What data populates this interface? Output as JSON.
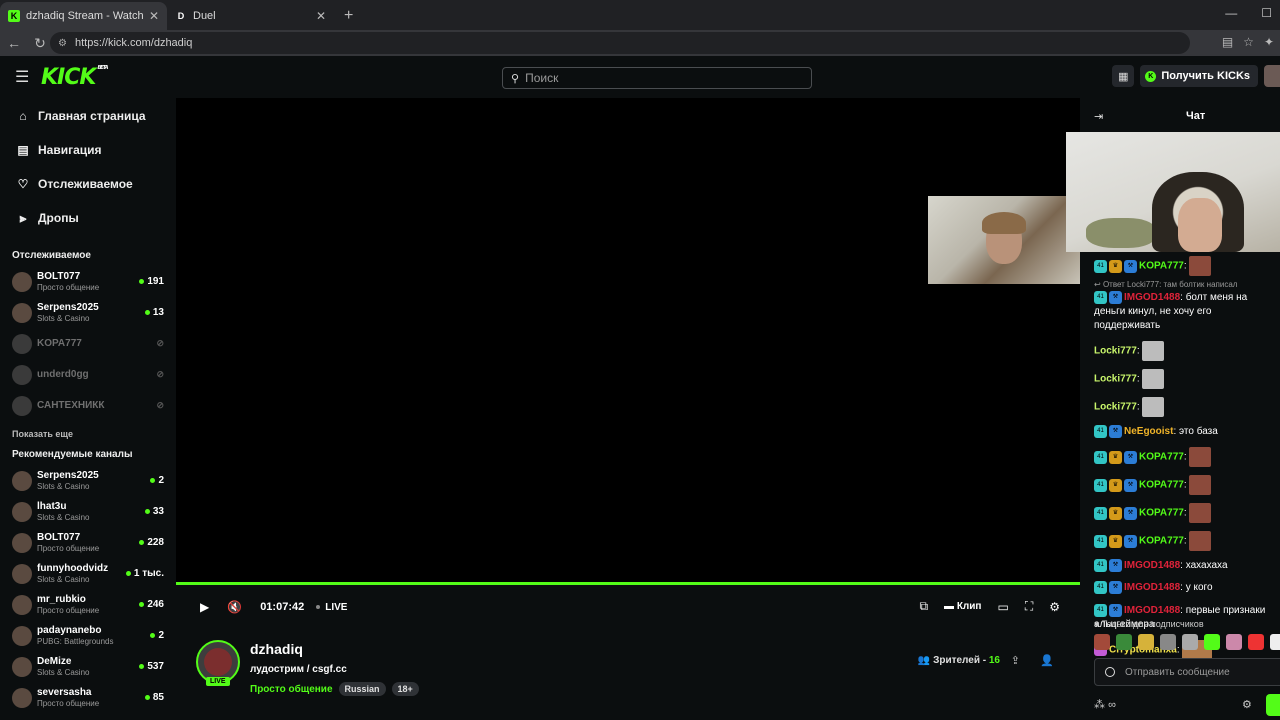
{
  "browser": {
    "tabs": [
      {
        "title": "dzhadiq Stream - Watch Live on K",
        "favicon": "K",
        "favicon_color": "#53fc18",
        "active": true
      },
      {
        "title": "Duel",
        "favicon": "D",
        "favicon_color": "#ffffff",
        "active": false
      }
    ],
    "url": "https://kick.com/dzhadiq"
  },
  "header": {
    "logo": "KICK",
    "beta": "BETA",
    "search_placeholder": "Поиск",
    "get_kicks": "Получить KICKs"
  },
  "sidebar": {
    "nav": [
      {
        "label": "Главная страница",
        "icon": "home-icon"
      },
      {
        "label": "Навигация",
        "icon": "browse-icon"
      },
      {
        "label": "Отслеживаемое",
        "icon": "heart-icon"
      },
      {
        "label": "Дропы",
        "icon": "drops-icon"
      }
    ],
    "following_title": "Отслеживаемое",
    "following": [
      {
        "name": "BOLT077",
        "category": "Просто общение",
        "viewers": "191",
        "live": true
      },
      {
        "name": "Serpens2025",
        "category": "Slots & Casino",
        "viewers": "13",
        "live": true
      },
      {
        "name": "KOPA777",
        "category": "",
        "viewers": "",
        "live": false
      },
      {
        "name": "underd0gg",
        "category": "",
        "viewers": "",
        "live": false
      },
      {
        "name": "САНТЕХНИКК",
        "category": "",
        "viewers": "",
        "live": false
      }
    ],
    "show_more": "Показать еще",
    "recommended_title": "Рекомендуемые каналы",
    "recommended": [
      {
        "name": "Serpens2025",
        "category": "Slots & Casino",
        "viewers": "2"
      },
      {
        "name": "lhat3u",
        "category": "Slots & Casino",
        "viewers": "33"
      },
      {
        "name": "BOLT077",
        "category": "Просто общение",
        "viewers": "228"
      },
      {
        "name": "funnyhoodvidz",
        "category": "Slots & Casino",
        "viewers": "1 тыс."
      },
      {
        "name": "mr_rubkio",
        "category": "Просто общение",
        "viewers": "246"
      },
      {
        "name": "padaynanebo",
        "category": "PUBG: Battlegrounds",
        "viewers": "2"
      },
      {
        "name": "DeMize",
        "category": "Slots & Casino",
        "viewers": "537"
      },
      {
        "name": "seversasha",
        "category": "Просто общение",
        "viewers": "85"
      }
    ]
  },
  "player": {
    "time": "01:07:42",
    "live": "LIVE",
    "clip": "Клип",
    "progress_percent": 100
  },
  "stream": {
    "streamer": "dzhadiq",
    "title": "лудострим / csgf.cc",
    "category": "Просто общение",
    "tags": [
      "Russian",
      "18+"
    ],
    "live_badge": "LIVE",
    "viewers_label": "Зрителей - ",
    "viewers": "16"
  },
  "chat": {
    "title": "Чат",
    "reply_note": "Ответ Locki777: там болтик написал",
    "messages": [
      {
        "user": "KOPA777",
        "color": "#53fc18",
        "text": "",
        "badges": [
          "sub",
          "crown",
          "mod"
        ],
        "emote": true
      },
      {
        "user": "IMGOD1488",
        "color": "#e0233a",
        "text": "болт меня на деньги кинул, не хочу его поддерживать",
        "badges": [
          "sub",
          "mod"
        ],
        "emote": false
      },
      {
        "user": "Locki777",
        "color": "#c8f56b",
        "text": "",
        "badges": [],
        "emote": true,
        "emote_type": "cat"
      },
      {
        "user": "Locki777",
        "color": "#c8f56b",
        "text": "",
        "badges": [],
        "emote": true,
        "emote_type": "cat"
      },
      {
        "user": "Locki777",
        "color": "#c8f56b",
        "text": "",
        "badges": [],
        "emote": true,
        "emote_type": "cat"
      },
      {
        "user": "NeEgooist",
        "color": "#f0b429",
        "text": "это база",
        "badges": [
          "sub",
          "mod"
        ],
        "emote": false
      },
      {
        "user": "KOPA777",
        "color": "#53fc18",
        "text": "",
        "badges": [
          "sub",
          "crown",
          "mod"
        ],
        "emote": true
      },
      {
        "user": "KOPA777",
        "color": "#53fc18",
        "text": "",
        "badges": [
          "sub",
          "crown",
          "mod"
        ],
        "emote": true
      },
      {
        "user": "KOPA777",
        "color": "#53fc18",
        "text": "",
        "badges": [
          "sub",
          "crown",
          "mod"
        ],
        "emote": true
      },
      {
        "user": "KOPA777",
        "color": "#53fc18",
        "text": "",
        "badges": [
          "sub",
          "crown",
          "mod"
        ],
        "emote": true
      },
      {
        "user": "IMGOD1488",
        "color": "#e0233a",
        "text": "хахахаха",
        "badges": [
          "sub",
          "mod"
        ],
        "emote": false
      },
      {
        "user": "IMGOD1488",
        "color": "#e0233a",
        "text": "у кого",
        "badges": [
          "sub",
          "mod"
        ],
        "emote": false
      },
      {
        "user": "IMGOD1488",
        "color": "#e0233a",
        "text": "первые признаки альцгеймера",
        "badges": [
          "sub",
          "mod"
        ],
        "emote": false
      },
      {
        "user": "Crryptomanxa",
        "color": "#f0e14a",
        "text": "",
        "badges": [
          "vip"
        ],
        "emote": true,
        "emote_type": "wide"
      }
    ],
    "sub_only": "Только для подписчиков",
    "input_placeholder": "Отправить сообщение",
    "infinity": "∞"
  }
}
